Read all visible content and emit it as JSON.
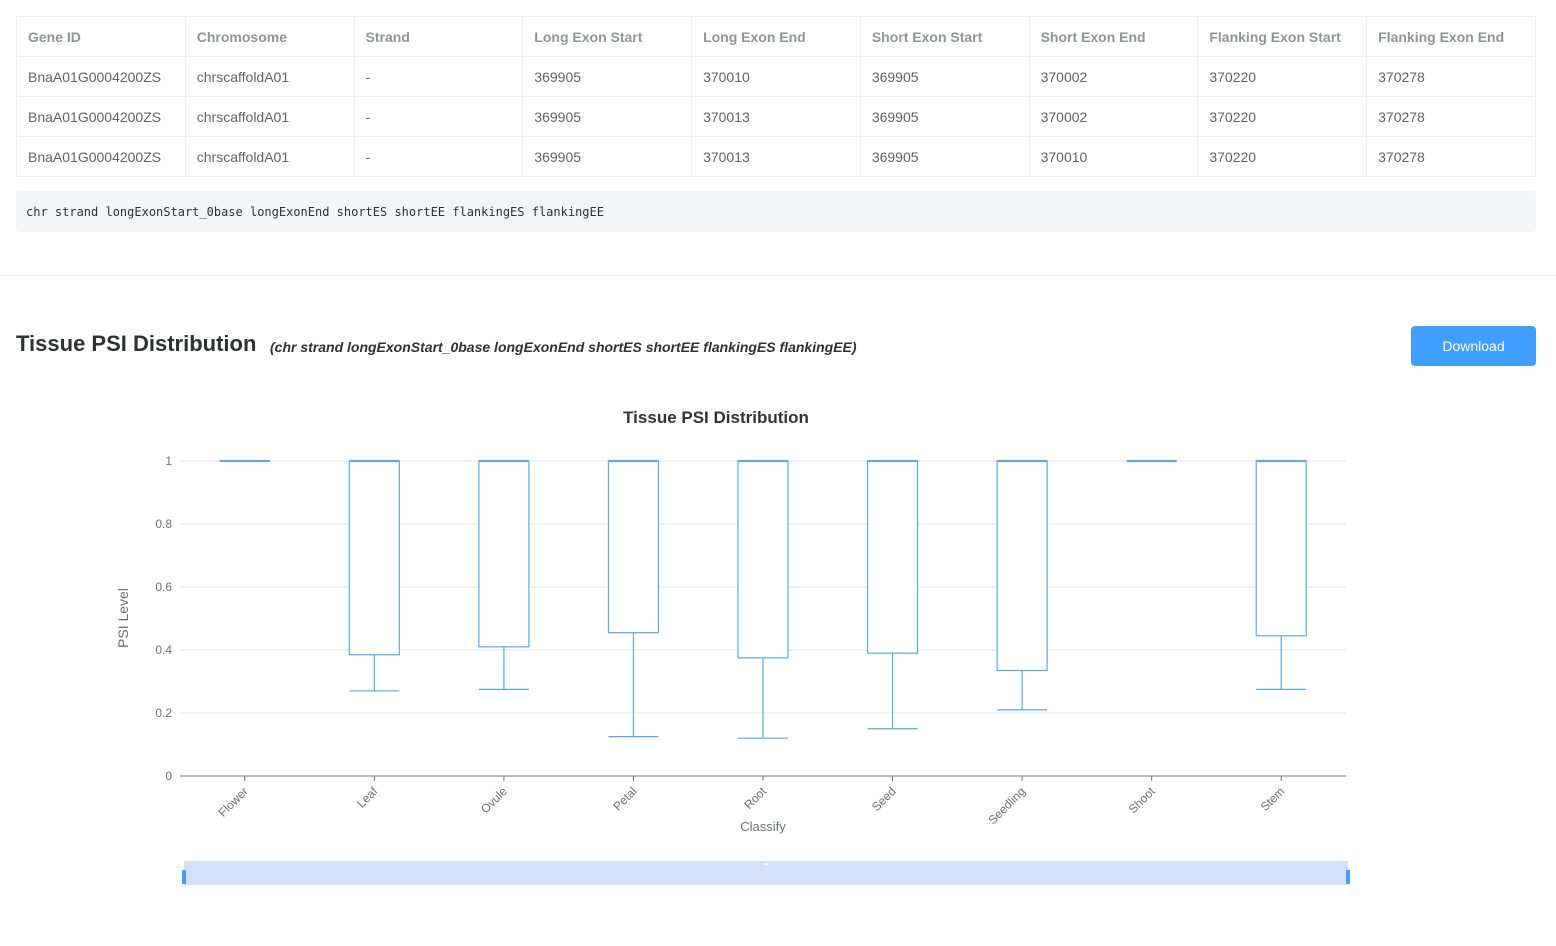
{
  "table": {
    "headers": [
      "Gene ID",
      "Chromosome",
      "Strand",
      "Long Exon Start",
      "Long Exon End",
      "Short Exon Start",
      "Short Exon End",
      "Flanking Exon Start",
      "Flanking Exon End"
    ],
    "rows": [
      [
        "BnaA01G0004200ZS",
        "chrscaffoldA01",
        "-",
        "369905",
        "370010",
        "369905",
        "370002",
        "370220",
        "370278"
      ],
      [
        "BnaA01G0004200ZS",
        "chrscaffoldA01",
        "-",
        "369905",
        "370013",
        "369905",
        "370002",
        "370220",
        "370278"
      ],
      [
        "BnaA01G0004200ZS",
        "chrscaffoldA01",
        "-",
        "369905",
        "370013",
        "369905",
        "370010",
        "370220",
        "370278"
      ]
    ]
  },
  "format_box": {
    "text": "chr strand longExonStart_0base longExonEnd shortES shortEE flankingES flankingEE"
  },
  "section": {
    "title": "Tissue PSI Distribution",
    "subtitle": "(chr strand longExonStart_0base longExonEnd shortES shortEE flankingES flankingEE)",
    "download_label": "Download"
  },
  "colors": {
    "accent": "#409eff",
    "box_stroke": "#5aa9ea",
    "grid": "#e6e6e6"
  },
  "chart_data": {
    "type": "boxplot",
    "title": "Tissue PSI Distribution",
    "xlabel": "Classify",
    "ylabel": "PSI Level",
    "ylim": [
      0,
      1
    ],
    "yticks": [
      "0",
      "0.2",
      "0.4",
      "0.6",
      "0.8",
      "1"
    ],
    "grid": true,
    "categories": [
      "Flower",
      "Leaf",
      "Ovule",
      "Petal",
      "Root",
      "Seed",
      "Seedling",
      "Shoot",
      "Stem"
    ],
    "boxes": [
      {
        "min": 1,
        "q1": 1,
        "median": 1,
        "q3": 1,
        "max": 1
      },
      {
        "min": 0.27,
        "q1": 0.385,
        "median": 1,
        "q3": 1,
        "max": 1
      },
      {
        "min": 0.275,
        "q1": 0.41,
        "median": 1,
        "q3": 1,
        "max": 1
      },
      {
        "min": 0.125,
        "q1": 0.455,
        "median": 1,
        "q3": 1,
        "max": 1
      },
      {
        "min": 0.12,
        "q1": 0.375,
        "median": 1,
        "q3": 1,
        "max": 1
      },
      {
        "min": 0.15,
        "q1": 0.39,
        "median": 1,
        "q3": 1,
        "max": 1
      },
      {
        "min": 0.21,
        "q1": 0.335,
        "median": 1,
        "q3": 1,
        "max": 1
      },
      {
        "min": 1,
        "q1": 1,
        "median": 1,
        "q3": 1,
        "max": 1
      },
      {
        "min": 0.275,
        "q1": 0.445,
        "median": 1,
        "q3": 1,
        "max": 1
      }
    ]
  }
}
